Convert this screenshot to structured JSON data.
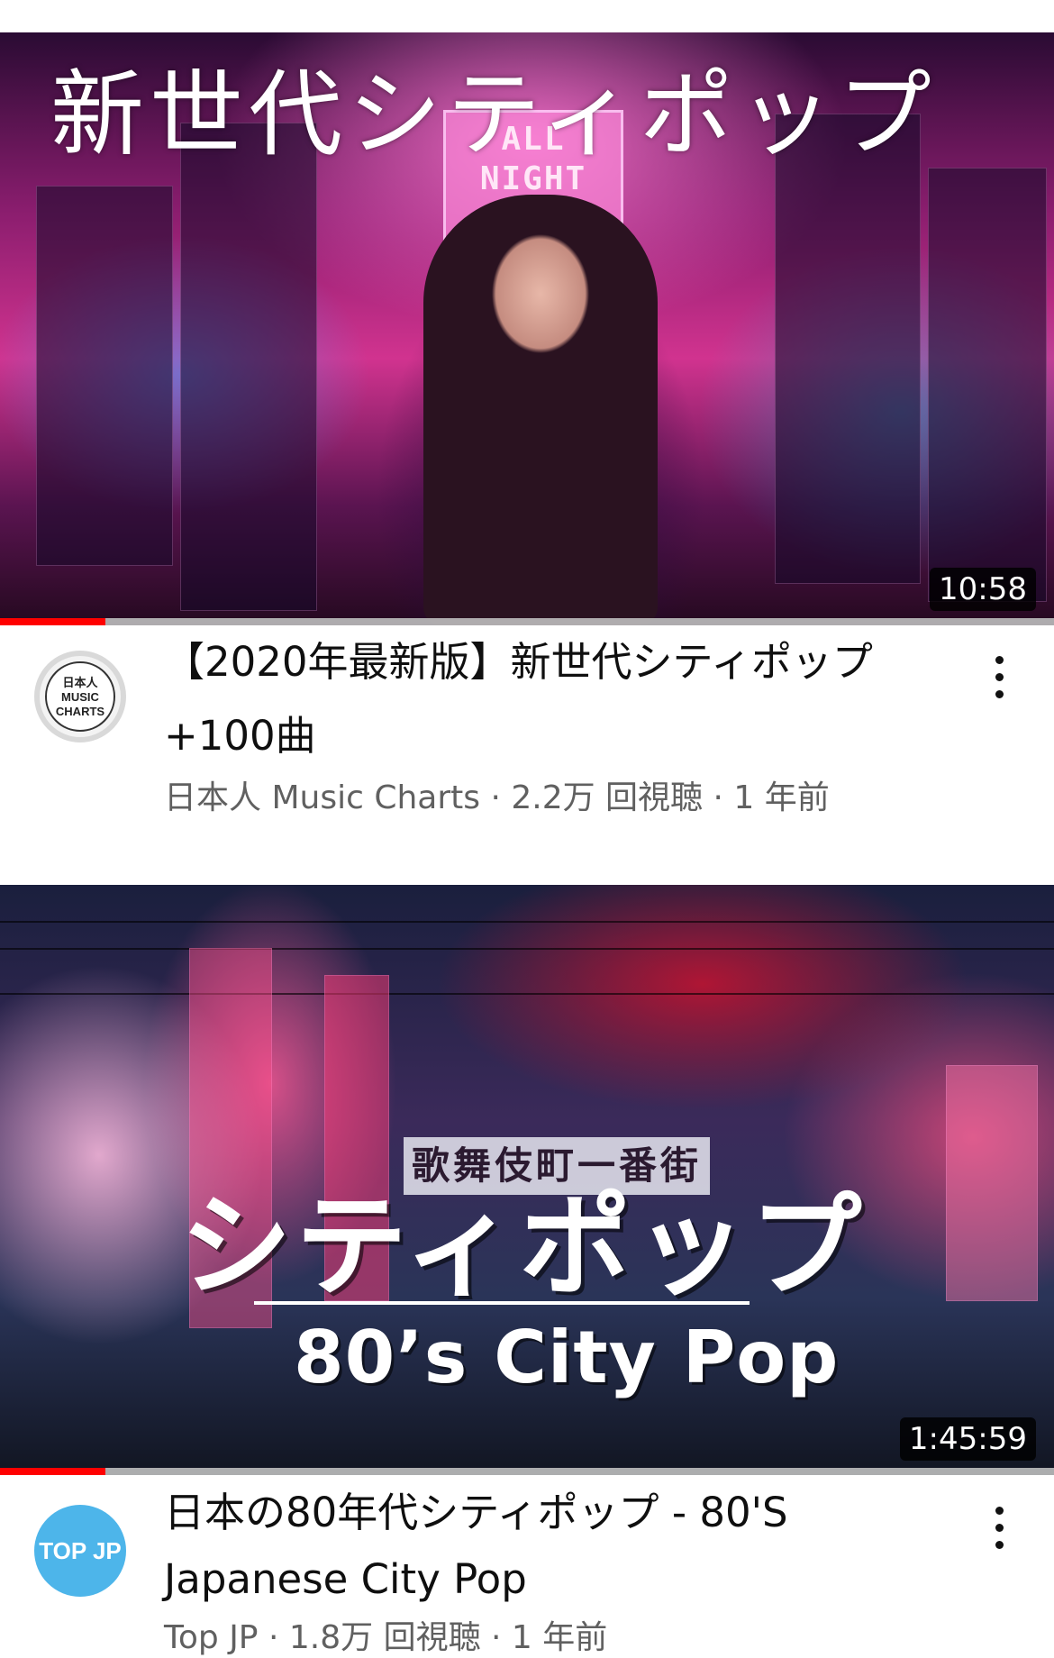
{
  "videos": [
    {
      "thumbnail": {
        "title_text": "新世代シティポップ",
        "sign_text": "ALL NIGHT LONG",
        "duration": "10:58",
        "progress_fraction": 0.1
      },
      "avatar_text": "日本人 MUSIC CHARTS",
      "title": "【2020年最新版】新世代シティポップ +100曲",
      "channel": "日本人 Music Charts",
      "views": "2.2万 回視聴",
      "age": "1 年前"
    },
    {
      "thumbnail": {
        "title_text": "シティポップ",
        "subtitle_text": "80’s City Pop",
        "sign_text": "歌舞伎町一番街",
        "duration": "1:45:59",
        "progress_fraction": 0.1
      },
      "avatar_text": "TOP JP",
      "title": "日本の80年代シティポップ - 80'S Japanese City Pop",
      "channel": "Top JP",
      "views": "1.8万 回視聴",
      "age": "1 年前"
    }
  ],
  "separator": " · ",
  "icons": {
    "menu": "more-vert-icon"
  },
  "colors": {
    "progress": "#ff0000",
    "title": "#0f0f0f",
    "meta": "#606060"
  }
}
